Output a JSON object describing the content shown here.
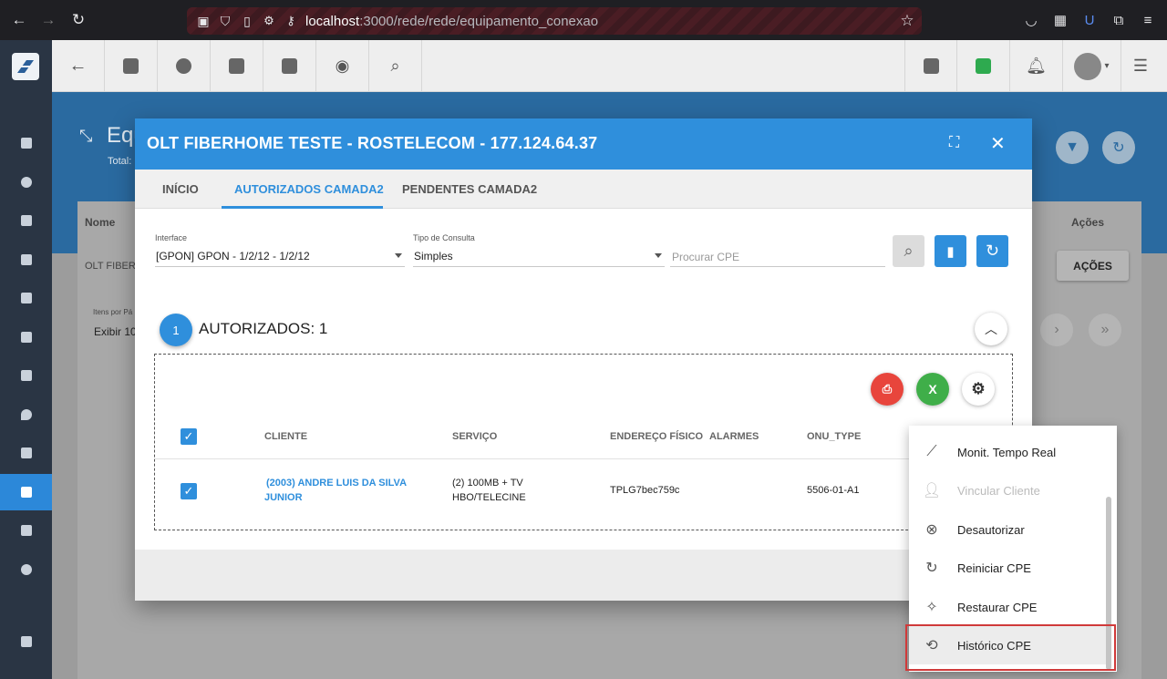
{
  "browser": {
    "url_host": "localhost",
    "url_path": ":3000/rede/rede/equipamento_conexao"
  },
  "background": {
    "title_partial": "Equ",
    "subtitle_partial": "Total:",
    "col_nome": "Nome",
    "col_acoes": "Ações",
    "row_name_partial": "OLT FIBER",
    "acoes_button": "AÇÕES",
    "items_label": "Itens por Pá",
    "exibir": "Exibir 10"
  },
  "modal": {
    "title": "OLT FIBERHOME TESTE - ROSTELECOM - 177.124.64.37",
    "tabs": [
      "INÍCIO",
      "AUTORIZADOS CAMADA2",
      "PENDENTES CAMADA2"
    ],
    "interface_label": "Interface",
    "interface_value": "[GPON] GPON - 1/2/12 - 1/2/12",
    "tipo_label": "Tipo de Consulta",
    "tipo_value": "Simples",
    "search_placeholder": "Procurar CPE",
    "section_count": "1",
    "section_title": "AUTORIZADOS: 1",
    "export_pdf": "PDF",
    "export_excel": "X",
    "table": {
      "headers": [
        "CLIENTE",
        "SERVIÇO",
        "ENDEREÇO FÍSICO",
        "ALARMES",
        "ONU_TYPE"
      ],
      "rows": [
        {
          "cliente_line1": "(2003) ANDRE LUIS DA SILVA",
          "cliente_line2": "JUNIOR",
          "servico_line1": "(2) 100MB + TV",
          "servico_line2": "HBO/TELECINE",
          "endereco": "TPLG7bec759c",
          "alarmes": "",
          "onu_type": "5506-01-A1"
        }
      ]
    }
  },
  "context_menu": {
    "items": [
      {
        "label": "Monit. Tempo Real",
        "icon": "chart-line-icon"
      },
      {
        "label": "Vincular Cliente",
        "icon": "person-add-icon"
      },
      {
        "label": "Desautorizar",
        "icon": "cancel-circle-icon"
      },
      {
        "label": "Reiniciar CPE",
        "icon": "refresh-icon"
      },
      {
        "label": "Restaurar CPE",
        "icon": "magic-wand-icon"
      },
      {
        "label": "Histórico CPE",
        "icon": "history-icon"
      }
    ]
  },
  "colors": {
    "primary": "#2f8fdc",
    "pdf_red": "#e8453c",
    "excel_green": "#3fae49",
    "sidebar_bg": "#2a3544",
    "highlight_border": "#d03a3a"
  }
}
